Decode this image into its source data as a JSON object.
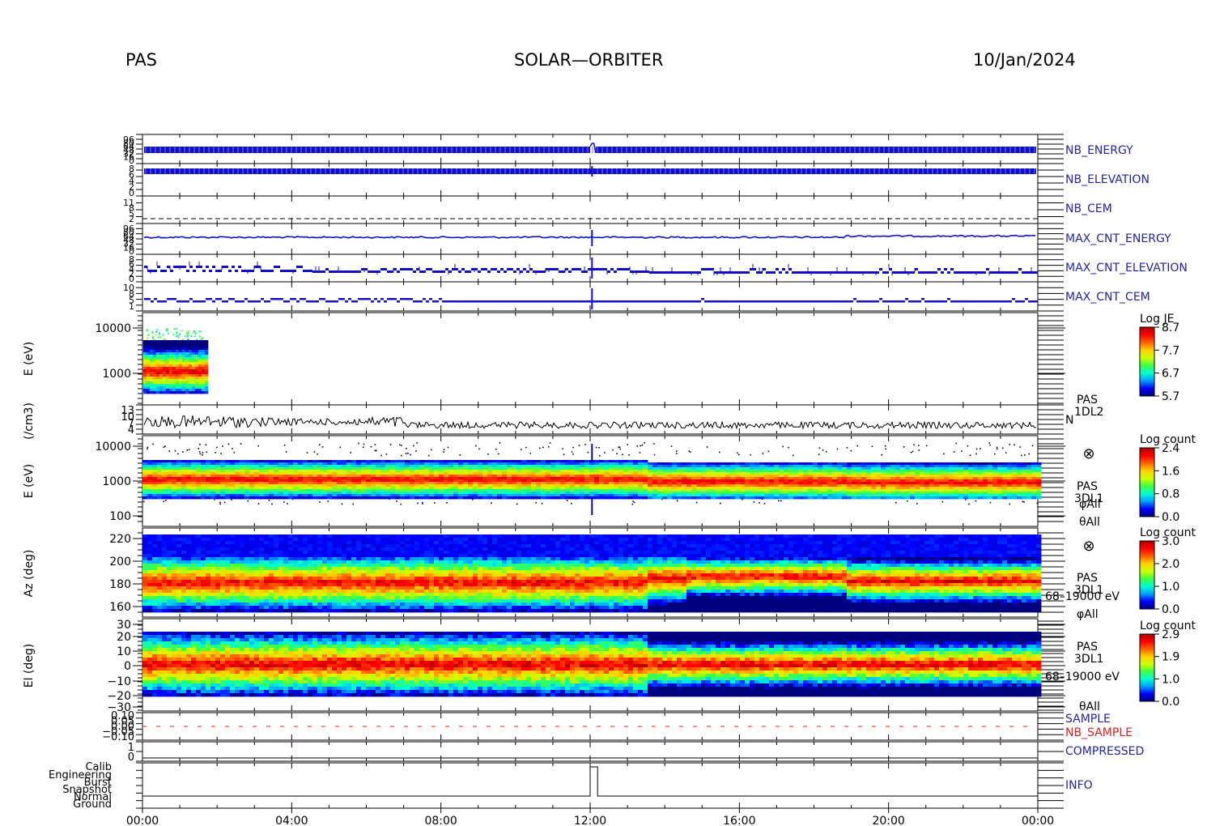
{
  "header": {
    "left": "PAS",
    "center": "SOLAR—ORBITER",
    "right": "10/Jan/2024"
  },
  "colors": {
    "trace_blue": "#1010c8",
    "nb_sample_red": "#e02020",
    "label_blue": "#2222aa",
    "colormap": [
      "#00007f",
      "#0000ff",
      "#00a0ff",
      "#00ffd0",
      "#40ff40",
      "#d0ff00",
      "#ffd000",
      "#ff6000",
      "#ff0000",
      "#b00000"
    ]
  },
  "chart_data": {
    "type": "multi-panel time series / spectrogram",
    "x_ticks": [
      "00:00",
      "04:00",
      "08:00",
      "12:00",
      "16:00",
      "20:00",
      "00:00"
    ],
    "x_range_hours": [
      0,
      24
    ],
    "panels": [
      {
        "id": "nb_energy",
        "label": "NB_ENERGY",
        "ticks": [
          "96",
          "80",
          "64",
          "48",
          "32",
          "16",
          "0"
        ]
      },
      {
        "id": "nb_elevation",
        "label": "NB_ELEVATION",
        "ticks": [
          "8",
          "6",
          "4",
          "2",
          "0"
        ]
      },
      {
        "id": "nb_cem",
        "label": "NB_CEM",
        "ticks": [
          "11",
          "8",
          "5",
          "2"
        ]
      },
      {
        "id": "max_cnt_energy",
        "label": "MAX_CNT_ENERGY",
        "ticks": [
          "96",
          "80",
          "64",
          "48",
          "32",
          "16",
          "0"
        ]
      },
      {
        "id": "max_cnt_elevation",
        "label": "MAX_CNT_ELEVATION",
        "ticks": [
          "8",
          "6",
          "4",
          "2",
          "0"
        ]
      },
      {
        "id": "max_cnt_cem",
        "label": "MAX_CNT_CEM",
        "ticks": [
          "10",
          "8",
          "5",
          "1"
        ]
      },
      {
        "id": "spec_1",
        "ylabel": "E (eV)",
        "ticks": [
          "10000",
          "1000"
        ],
        "data_end_hour": 1.7,
        "colorbar": {
          "title": "Log JE",
          "ticks": [
            "8.7",
            "7.7",
            "6.7",
            "5.7"
          ]
        }
      },
      {
        "id": "density",
        "ylabel": "(/cm3)",
        "ticks": [
          "13",
          "10",
          "7",
          "4"
        ],
        "side_labels": [
          "PAS",
          "1DL2",
          "N"
        ]
      },
      {
        "id": "spec_energy",
        "ylabel": "E (eV)",
        "ticks": [
          "10000",
          "1000",
          "100"
        ],
        "colorbar": {
          "title": "Log count",
          "ticks": [
            "2.4",
            "1.6",
            "0.8",
            "0.0"
          ]
        },
        "side_labels": [
          "PAS",
          "3DL1",
          "φAll",
          "θAll"
        ]
      },
      {
        "id": "spec_az",
        "ylabel": "Az (deg)",
        "ticks": [
          "220",
          "200",
          "180",
          "160"
        ],
        "colorbar": {
          "title": "Log count",
          "ticks": [
            "3.0",
            "2.0",
            "1.0",
            "0.0"
          ]
        },
        "side_labels": [
          "PAS",
          "3DL1",
          "68–19000 eV",
          "φAll"
        ]
      },
      {
        "id": "spec_el",
        "ylabel": "El (deg)",
        "ticks": [
          "30",
          "20",
          "10",
          "0",
          "−10",
          "−20",
          "−30"
        ],
        "colorbar": {
          "title": "Log count",
          "ticks": [
            "2.9",
            "1.9",
            "1.0",
            "0.0"
          ]
        },
        "side_labels": [
          "PAS",
          "3DL1",
          "68–19000 eV",
          "θAll"
        ]
      },
      {
        "id": "sample",
        "labels": [
          "SAMPLE",
          "NB_SAMPLE"
        ],
        "ticks": [
          "0.10",
          "0.05",
          "0.00",
          "−0.05",
          "−0.10"
        ]
      },
      {
        "id": "compressed",
        "label": "COMPRESSED",
        "ticks": [
          "1",
          "0"
        ]
      },
      {
        "id": "info",
        "label": "INFO",
        "ticks": [
          "Calib",
          "Engineering",
          "Burst",
          "Snapshot",
          "Normal",
          "Ground"
        ]
      }
    ]
  }
}
